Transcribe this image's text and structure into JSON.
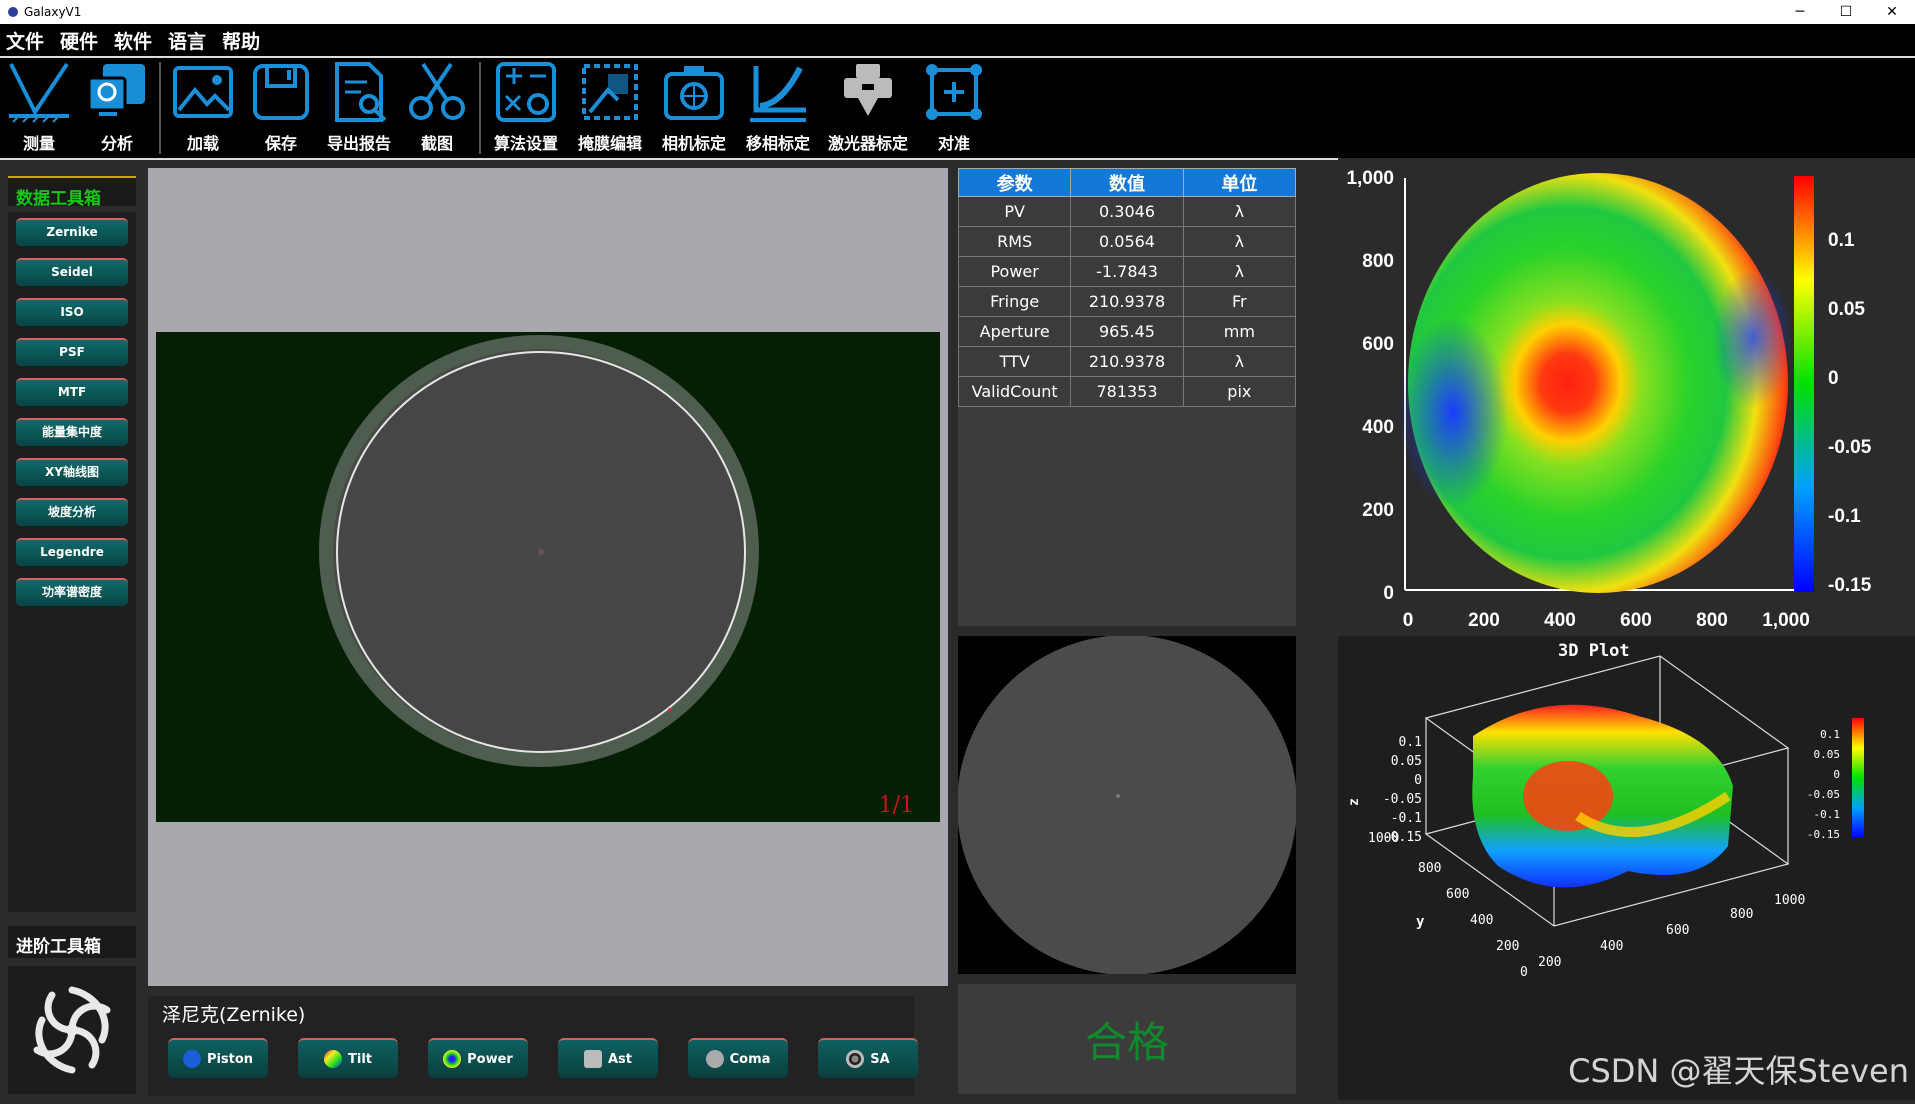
{
  "window": {
    "title": "GalaxyV1",
    "controls": [
      "─",
      "☐",
      "✕"
    ]
  },
  "menu": [
    "文件",
    "硬件",
    "软件",
    "语言",
    "帮助"
  ],
  "toolbar": {
    "group1": [
      {
        "label": "测量",
        "icon": "measure-icon"
      },
      {
        "label": "分析",
        "icon": "analysis-icon"
      }
    ],
    "group2": [
      {
        "label": "加载",
        "icon": "load-icon"
      },
      {
        "label": "保存",
        "icon": "save-icon"
      },
      {
        "label": "导出报告",
        "icon": "export-report-icon"
      },
      {
        "label": "截图",
        "icon": "screenshot-icon"
      }
    ],
    "group3": [
      {
        "label": "算法设置",
        "icon": "algorithm-settings-icon"
      },
      {
        "label": "掩膜编辑",
        "icon": "mask-edit-icon"
      },
      {
        "label": "相机标定",
        "icon": "camera-calibration-icon"
      },
      {
        "label": "移相标定",
        "icon": "phase-shift-calibration-icon"
      },
      {
        "label": "激光器标定",
        "icon": "laser-calibration-icon"
      },
      {
        "label": "对准",
        "icon": "alignment-icon"
      }
    ]
  },
  "left": {
    "title": "数据工具箱",
    "buttons": [
      "Zernike",
      "Seidel",
      "ISO",
      "PSF",
      "MTF",
      "能量集中度",
      "XY轴线图",
      "坡度分析",
      "Legendre",
      "功率谱密度"
    ],
    "title2": "进阶工具箱"
  },
  "viewer": {
    "page": "1/1"
  },
  "zernike": {
    "title": "泽尼克(Zernike)",
    "buttons": [
      "Piston",
      "Tilt",
      "Power",
      "Ast",
      "Coma",
      "SA"
    ]
  },
  "results": {
    "headers": [
      "参数",
      "数值",
      "单位"
    ],
    "rows": [
      [
        "PV",
        "0.3046",
        "λ"
      ],
      [
        "RMS",
        "0.0564",
        "λ"
      ],
      [
        "Power",
        "-1.7843",
        "λ"
      ],
      [
        "Fringe",
        "210.9378",
        "Fr"
      ],
      [
        "Aperture",
        "965.45",
        "mm"
      ],
      [
        "TTV",
        "210.9378",
        "λ"
      ],
      [
        "ValidCount",
        "781353",
        "pix"
      ]
    ]
  },
  "status": {
    "verdict": "合格",
    "color": "#0f8a2c"
  },
  "map": {
    "y_ticks": [
      "1,000",
      "800",
      "600",
      "400",
      "200",
      "0"
    ],
    "x_ticks": [
      "0",
      "200",
      "400",
      "600",
      "800",
      "1,000"
    ],
    "colorbar": [
      "0.1",
      "0.05",
      "0",
      "-0.05",
      "-0.1",
      "-0.15"
    ]
  },
  "plot3d": {
    "title": "3D Plot",
    "z_label": "z",
    "y_label": "y",
    "z_ticks": [
      "0.1",
      "0.05",
      "0",
      "-0.05",
      "-0.1",
      "-0.15"
    ],
    "colorbar": [
      "0.1",
      "0.05",
      "0",
      "-0.05",
      "-0.1",
      "-0.15"
    ],
    "y_ticks": [
      "1000",
      "800",
      "600",
      "400",
      "200",
      "0"
    ],
    "x_ticks": [
      "200",
      "400",
      "600",
      "800",
      "1000"
    ]
  },
  "watermark": "CSDN @翟天保Steven"
}
